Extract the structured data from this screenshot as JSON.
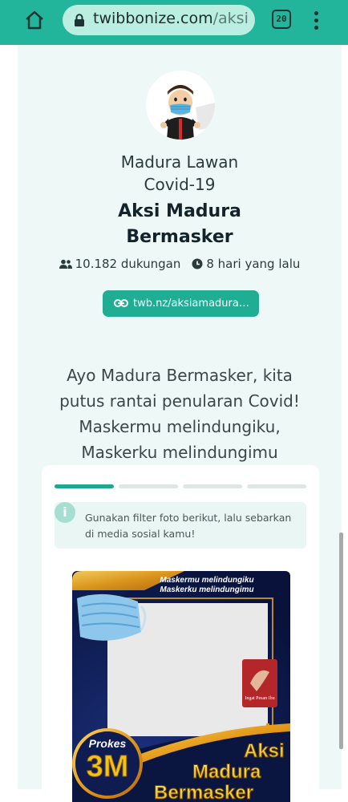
{
  "browser": {
    "domain": "twibbonize.com",
    "path": "/aksi",
    "tab_count": "20"
  },
  "campaign": {
    "community": "Madura Lawan Covid-19",
    "title": "Aksi Madura Bermasker",
    "supporters": "10.182 dukungan",
    "time": "8 hari yang lalu",
    "link": "twb.nz/aksiamadura…",
    "description": "Ayo Madura Bermasker, kita putus rantai penularan Covid! Maskermu melindungiku, Maskerku melindungimu"
  },
  "steps": {
    "total": 4,
    "current": 1,
    "info_text": "Gunakan filter foto berikut, lalu sebarkan di media sosial kamu!"
  },
  "frame": {
    "slogan_line1": "Maskermu melindungiku",
    "slogan_line2": "Maskerku melindungimu",
    "badge_top": "Prokes",
    "badge_main": "3M",
    "logo_text": "Ingat Pesan Ibu",
    "title_line1": "Aksi",
    "title_line2": "Madura",
    "title_line3": "Bermasker"
  },
  "colors": {
    "brand": "#22b59b",
    "button": "#1fad93",
    "frame_navy": "#0e1c52",
    "frame_gold": "#e9a623",
    "frame_yellow": "#f7d21d"
  },
  "icons": [
    "home-icon",
    "lock-icon",
    "tabs-icon",
    "menu-icon",
    "users-icon",
    "clock-icon",
    "link-icon",
    "info-icon"
  ]
}
